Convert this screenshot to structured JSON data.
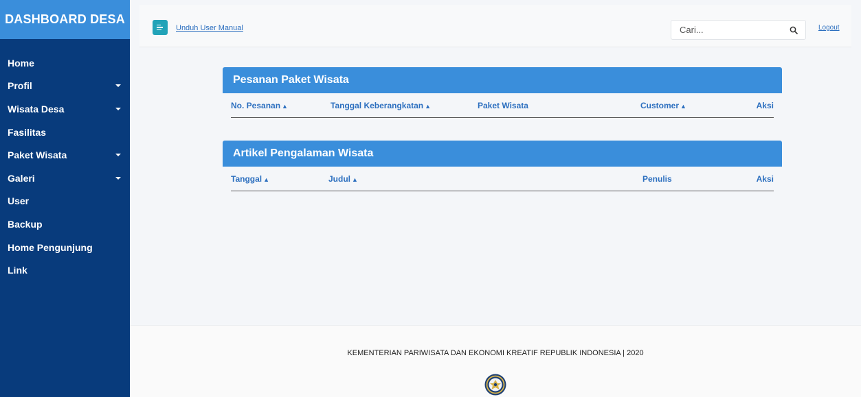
{
  "sidebar": {
    "brand": "DASHBOARD DESA",
    "items": [
      {
        "label": "Home",
        "dropdown": false
      },
      {
        "label": "Profil",
        "dropdown": true
      },
      {
        "label": "Wisata Desa",
        "dropdown": true
      },
      {
        "label": "Fasilitas",
        "dropdown": false
      },
      {
        "label": "Paket Wisata",
        "dropdown": true
      },
      {
        "label": "Galeri",
        "dropdown": true
      },
      {
        "label": "User",
        "dropdown": false
      },
      {
        "label": "Backup",
        "dropdown": false
      },
      {
        "label": "Home Pengunjung",
        "dropdown": false
      },
      {
        "label": "Link",
        "dropdown": false
      }
    ]
  },
  "topbar": {
    "manual_icon": "document-lines-icon",
    "manual_label": "Unduh User Manual",
    "search_placeholder": "Cari...",
    "search_icon": "search-icon",
    "logout_label": "Logout"
  },
  "orders": {
    "title": "Pesanan Paket Wisata",
    "columns": [
      {
        "label": "No. Pesanan",
        "sortable": true
      },
      {
        "label": "Tanggal Keberangkatan",
        "sortable": true
      },
      {
        "label": "Paket Wisata",
        "sortable": false
      },
      {
        "label": "Customer",
        "sortable": true
      },
      {
        "label": "Aksi",
        "sortable": false
      }
    ]
  },
  "articles": {
    "title": "Artikel Pengalaman Wisata",
    "columns": [
      {
        "label": "Tanggal",
        "sortable": true
      },
      {
        "label": "Judul",
        "sortable": true
      },
      {
        "label": "Penulis",
        "sortable": false
      },
      {
        "label": "Aksi",
        "sortable": false
      }
    ]
  },
  "footer": {
    "text": "KEMENTERIAN PARIWISATA DAN EKONOMI KREATIF REPUBLIK INDONESIA | 2020",
    "emblem_icon": "ministry-emblem-icon"
  },
  "colors": {
    "sidebar": "#083b7c",
    "accent": "#3a8edb",
    "link": "#2c6fbf",
    "manual_button": "#22a3b8"
  }
}
